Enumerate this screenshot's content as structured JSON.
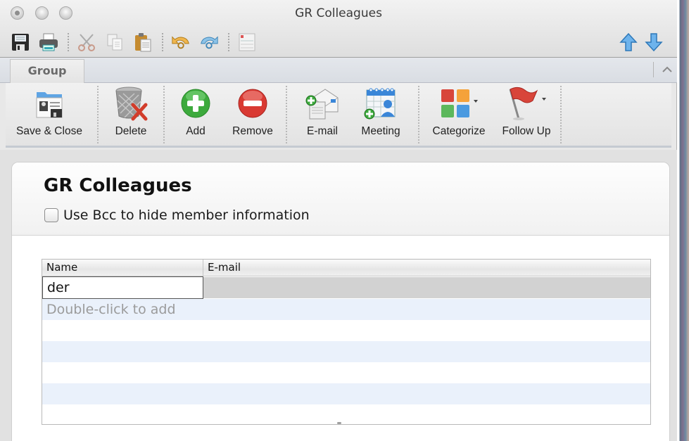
{
  "window": {
    "title": "GR Colleagues",
    "traffic_lights": [
      "close",
      "minimize",
      "zoom"
    ]
  },
  "quick_toolbar": {
    "items": [
      {
        "id": "save",
        "icon": "floppy-disk-icon"
      },
      {
        "id": "print",
        "icon": "printer-icon"
      },
      {
        "id": "cut",
        "icon": "scissors-icon"
      },
      {
        "id": "copy",
        "icon": "copy-icon"
      },
      {
        "id": "paste",
        "icon": "clipboard-icon"
      },
      {
        "id": "undo",
        "icon": "undo-icon"
      },
      {
        "id": "redo",
        "icon": "redo-icon"
      },
      {
        "id": "form",
        "icon": "form-icon"
      }
    ],
    "nav": [
      {
        "id": "previous",
        "icon": "arrow-up-icon"
      },
      {
        "id": "next",
        "icon": "arrow-down-icon"
      }
    ]
  },
  "ribbon": {
    "tabs": [
      {
        "label": "Group",
        "active": true
      }
    ],
    "collapse_icon": "chevron-up-icon",
    "buttons": [
      {
        "id": "save-close",
        "label": "Save & Close",
        "icon": "save-close-icon"
      },
      {
        "id": "delete",
        "label": "Delete",
        "icon": "trash-icon"
      },
      {
        "id": "add",
        "label": "Add",
        "icon": "plus-circle-icon"
      },
      {
        "id": "remove",
        "label": "Remove",
        "icon": "minus-circle-icon"
      },
      {
        "id": "email",
        "label": "E-mail",
        "icon": "new-email-icon"
      },
      {
        "id": "meeting",
        "label": "Meeting",
        "icon": "new-meeting-icon"
      },
      {
        "id": "categorize",
        "label": "Categorize",
        "icon": "categories-icon",
        "has_dropdown": true
      },
      {
        "id": "follow-up",
        "label": "Follow Up",
        "icon": "flag-icon",
        "has_dropdown": true
      }
    ]
  },
  "group": {
    "title": "GR Colleagues",
    "bcc_label": "Use Bcc to hide member information",
    "bcc_checked": false
  },
  "members_table": {
    "columns": [
      "Name",
      "E-mail"
    ],
    "editing_row": {
      "name": "der",
      "email": ""
    },
    "add_placeholder": "Double-click to add",
    "empty_rows": 5
  },
  "colors": {
    "row_alt": "#eaf1fb",
    "editing_row_bg": "#d2d2d2",
    "add_green": "#3daa3d",
    "remove_red": "#d93a33"
  }
}
